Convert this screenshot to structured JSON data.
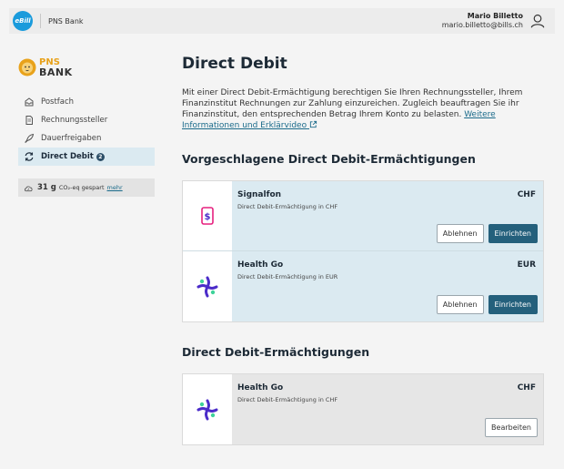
{
  "topbar": {
    "logo_text": "eBill",
    "bank_name": "PNS Bank",
    "user_name": "Mario Billetto",
    "user_email": "mario.billetto@bills.ch"
  },
  "brand": {
    "line1": "PNS",
    "line2": "BANK"
  },
  "sidebar": {
    "items": [
      {
        "label": "Postfach",
        "icon": "inbox-icon"
      },
      {
        "label": "Rechnungssteller",
        "icon": "document-icon"
      },
      {
        "label": "Dauerfreigaben",
        "icon": "rocket-icon"
      },
      {
        "label": "Direct Debit",
        "icon": "refresh-icon",
        "badge": "2"
      }
    ],
    "co2": {
      "value": "31 g",
      "text": "CO₂-eq gespart",
      "link": "mehr"
    }
  },
  "main": {
    "title": "Direct Debit",
    "intro": "Mit einer Direct Debit-Ermächtigung berechtigen Sie Ihren Rechnungssteller, Ihrem Finanzinstitut Rechnungen zur Zahlung einzureichen. Zugleich beauftragen Sie ihr Finanzinstitut, den entsprechenden Betrag Ihrem Konto zu belasten.",
    "intro_link": "Weitere Informationen und Erklärvideo"
  },
  "suggested": {
    "title": "Vorgeschlagene Direct Debit-Ermächtigungen",
    "cards": [
      {
        "name": "Signalfon",
        "subtitle": "Direct Debit-Ermächtigung in CHF",
        "currency": "CHF",
        "reject_label": "Ablehnen",
        "setup_label": "Einrichten"
      },
      {
        "name": "Health Go",
        "subtitle": "Direct Debit-Ermächtigung in EUR",
        "currency": "EUR",
        "reject_label": "Ablehnen",
        "setup_label": "Einrichten"
      }
    ]
  },
  "authorizations": {
    "title": "Direct Debit-Ermächtigungen",
    "cards": [
      {
        "name": "Health Go",
        "subtitle": "Direct Debit-Ermächtigung in CHF",
        "currency": "CHF",
        "edit_label": "Bearbeiten"
      }
    ]
  },
  "colors": {
    "accent": "#24607c",
    "card_bg": "#dbeaf1",
    "ebill_blue": "#1a9bdc",
    "pns_orange": "#e8a21b",
    "signalfon_pink": "#e6217f",
    "healthgo_purple": "#4b2cc9",
    "healthgo_green": "#3ed29a"
  }
}
